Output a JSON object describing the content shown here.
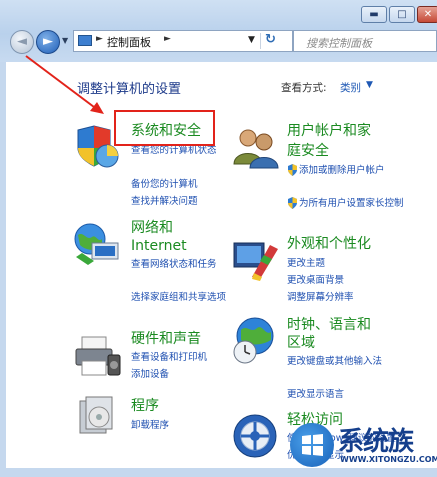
{
  "window": {
    "minimize": "▬",
    "maximize": "□",
    "close": "✕"
  },
  "nav": {
    "back": "◄",
    "forward": "►",
    "history_dropdown": "▼"
  },
  "address": {
    "separator": "►",
    "path": "控制面板",
    "dropdown": "▼",
    "refresh": "↻"
  },
  "search": {
    "placeholder": "搜索控制面板"
  },
  "header": {
    "title": "调整计算机的设置",
    "view_by_label": "查看方式:",
    "view_by_value": "类别",
    "view_dropdown": "▼"
  },
  "categories": [
    {
      "id": "system-security",
      "icon": "shield-pie-icon",
      "title": "系统和安全",
      "links": [
        "查看您的计算机状态",
        "备份您的计算机",
        "查找并解决问题"
      ]
    },
    {
      "id": "network",
      "icon": "network-globe-icon",
      "title_lines": [
        "网络和",
        "Internet"
      ],
      "links": [
        "查看网络状态和任务",
        "选择家庭组和共享选项"
      ]
    },
    {
      "id": "hardware",
      "icon": "printer-icon",
      "title": "硬件和声音",
      "links": [
        "查看设备和打印机",
        "添加设备"
      ]
    },
    {
      "id": "programs",
      "icon": "programs-icon",
      "title": "程序",
      "links": [
        "卸载程序"
      ]
    },
    {
      "id": "user-accounts",
      "icon": "users-icon",
      "title_lines": [
        "用户帐户和家",
        "庭安全"
      ],
      "links": [
        "添加或删除用户帐户",
        "为所有用户设置家长控制"
      ]
    },
    {
      "id": "appearance",
      "icon": "paint-icon",
      "title": "外观和个性化",
      "links": [
        "更改主题",
        "更改桌面背景",
        "调整屏幕分辨率"
      ]
    },
    {
      "id": "clock",
      "icon": "clock-globe-icon",
      "title_lines": [
        "时钟、语言和",
        "区域"
      ],
      "links": [
        "更改键盘或其他输入法",
        "更改显示语言"
      ]
    },
    {
      "id": "ease-of-access",
      "icon": "ease-of-access-icon",
      "title": "轻松访问",
      "links": [
        "使用Windows建议的设置",
        "优化视频显示"
      ]
    }
  ],
  "watermark": {
    "text": "系统族",
    "url": "WWW.XITONGZU.COM"
  },
  "colors": {
    "link": "#1e4fb0",
    "category_title": "#1a8a20",
    "page_title": "#1d3a8a",
    "annotation": "#e2231a"
  }
}
